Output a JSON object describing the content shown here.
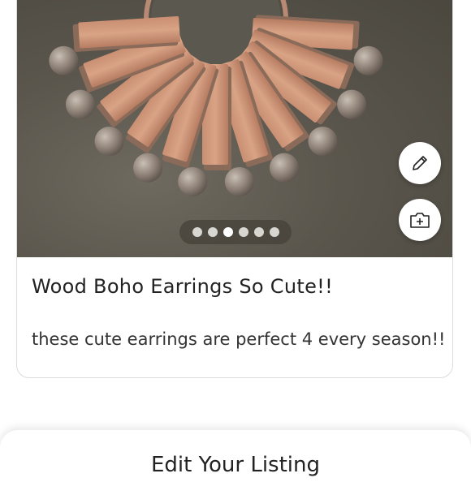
{
  "listing": {
    "title": "Wood Boho Earrings So Cute!!",
    "description": "these cute earrings are perfect 4 every season!!",
    "carousel": {
      "count": 6,
      "active_index": 2
    }
  },
  "actions": {
    "edit_icon": "pencil-icon",
    "add_photo_icon": "camera-plus-icon"
  },
  "sheet": {
    "title": "Edit Your Listing"
  }
}
